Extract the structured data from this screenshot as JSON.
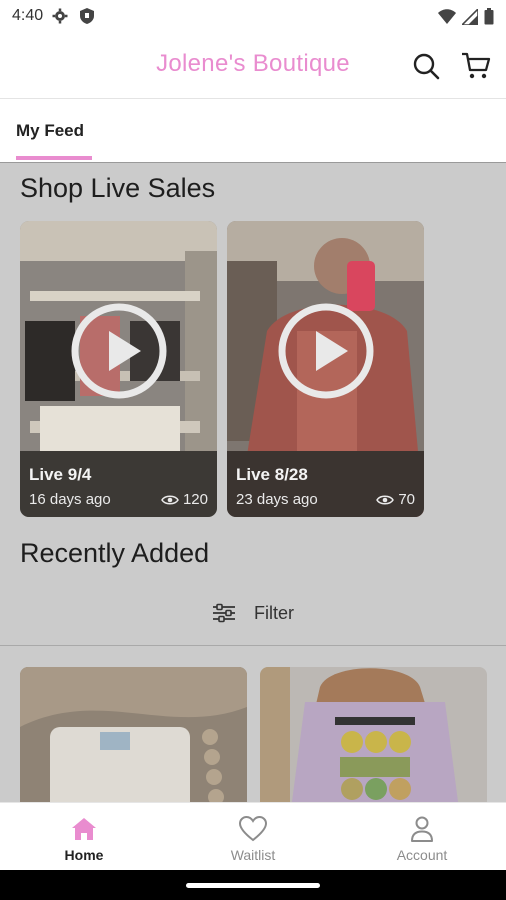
{
  "status_bar": {
    "time": "4:40"
  },
  "header": {
    "title": "Jolene's Boutique"
  },
  "tabs": [
    {
      "label": "My Feed",
      "active": true
    }
  ],
  "live_sales": {
    "title": "Shop Live Sales",
    "items": [
      {
        "label": "Live 9/4",
        "ago": "16 days ago",
        "views": "120"
      },
      {
        "label": "Live 8/28",
        "ago": "23 days ago",
        "views": "70"
      }
    ]
  },
  "recent": {
    "title": "Recently Added",
    "filter_label": "Filter"
  },
  "bottom_nav": [
    {
      "label": "Home",
      "icon": "home-icon",
      "active": true
    },
    {
      "label": "Waitlist",
      "icon": "heart-icon",
      "active": false
    },
    {
      "label": "Account",
      "icon": "person-icon",
      "active": false
    }
  ],
  "colors": {
    "brand": "#e98ccf",
    "overlay": "#cbcbcb"
  }
}
